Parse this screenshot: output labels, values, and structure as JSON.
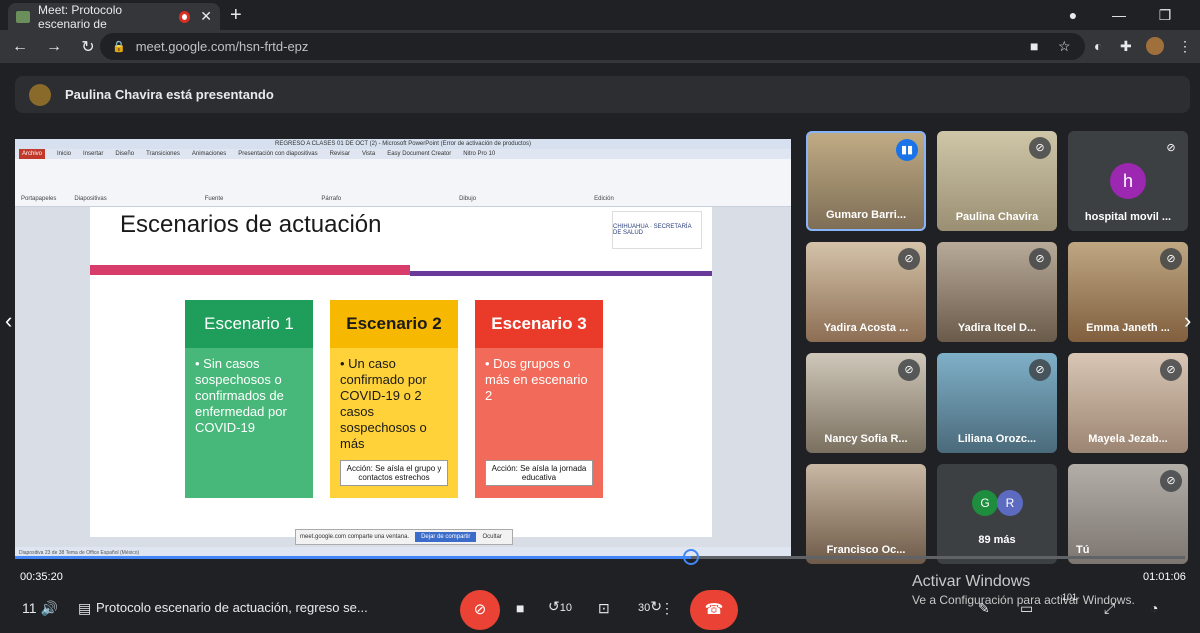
{
  "browser": {
    "tab_title": "Meet: Protocolo escenario de",
    "url": "meet.google.com/hsn-frtd-epz",
    "new_tab": "+",
    "close": "✕",
    "minimize": "—",
    "maximize": "❐"
  },
  "presenting_banner": "Paulina Chavira está presentando",
  "powerpoint": {
    "window_title": "REGRESO A CLASES 01 DE OCT (2) - Microsoft PowerPoint (Error de activación de productos)",
    "ribbon_tabs": [
      "Archivo",
      "Inicio",
      "Insertar",
      "Diseño",
      "Transiciones",
      "Animaciones",
      "Presentación con diapositivas",
      "Revisar",
      "Vista",
      "Easy Document Creator",
      "Nitro Pro 10"
    ],
    "ribbon_groups": [
      "Portapapeles",
      "Diapositivas",
      "Fuente",
      "Párrafo",
      "Dibujo",
      "Edición"
    ],
    "status": "Diapositiva 23 de 38   Tema de Office   Español (México)"
  },
  "slide": {
    "title": "Escenarios de actuación",
    "logo_text": "CHIHUAHUA · SECRETARÍA DE SALUD",
    "cards": [
      {
        "title": "Escenario 1",
        "body": "• Sin casos sospechosos o confirmados de enfermedad por COVID-19",
        "note": ""
      },
      {
        "title": "Escenario 2",
        "body": "• Un caso confirmado por COVID-19 o 2 casos sospechosos o más",
        "note": "Acción: Se aísla el grupo y contactos estrechos"
      },
      {
        "title": "Escenario 3",
        "body": "• Dos grupos o más en escenario 2",
        "note": "Acción: Se aísla la jornada educativa"
      }
    ]
  },
  "share_bar": {
    "text": "meet.google.com comparte una ventana.",
    "stop": "Dejar de compartir",
    "hide": "Ocultar"
  },
  "participants": [
    {
      "name": "Gumaro Barri...",
      "state": "speaking"
    },
    {
      "name": "Paulina Chavira",
      "state": "muted"
    },
    {
      "name": "hospital movil ...",
      "state": "muted",
      "initial": "h"
    },
    {
      "name": "Yadira Acosta ...",
      "state": "muted"
    },
    {
      "name": "Yadira Itcel D...",
      "state": "muted"
    },
    {
      "name": "Emma Janeth ...",
      "state": "muted"
    },
    {
      "name": "Nancy Sofia R...",
      "state": "muted"
    },
    {
      "name": "Liliana Orozc...",
      "state": "muted"
    },
    {
      "name": "Mayela Jezab...",
      "state": "muted"
    },
    {
      "name": "Francisco Oc...",
      "state": "muted"
    },
    {
      "name": "89 más",
      "state": "",
      "avatars": [
        "G",
        "R"
      ]
    },
    {
      "name": "Tú",
      "state": "muted"
    }
  ],
  "player": {
    "elapsed": "00:35:20",
    "total": "01:01:06",
    "progress": 0.578,
    "volume_label": "11",
    "meeting_title": "Protocolo escenario de actuación, regreso se...",
    "rewind": "10",
    "forward": "30",
    "speed": "101"
  },
  "watermark": {
    "line1": "Activar Windows",
    "line2": "Ve a Configuración para activar Windows."
  },
  "colors": {
    "meet_bg": "#202124",
    "end_call": "#ea4335",
    "accent": "#4285f4",
    "scenario1": "#1e9e5a",
    "scenario2": "#f6b800",
    "scenario3": "#ea3b2a"
  }
}
